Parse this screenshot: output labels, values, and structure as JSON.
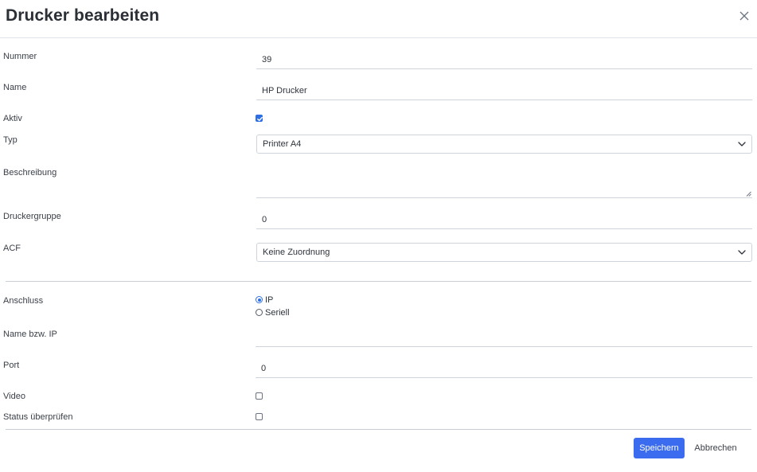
{
  "dialog": {
    "title": "Drucker bearbeiten",
    "close_icon": "close-icon"
  },
  "form": {
    "nummer": {
      "label": "Nummer",
      "value": "39"
    },
    "name": {
      "label": "Name",
      "value": "HP Drucker"
    },
    "aktiv": {
      "label": "Aktiv",
      "checked": true
    },
    "typ": {
      "label": "Typ",
      "selected": "Printer A4"
    },
    "beschreibung": {
      "label": "Beschreibung",
      "value": ""
    },
    "druckergruppe": {
      "label": "Druckergruppe",
      "value": "0"
    },
    "acf": {
      "label": "ACF",
      "selected": "Keine Zuordnung"
    },
    "anschluss": {
      "label": "Anschluss",
      "options": [
        {
          "label": "IP",
          "selected": true
        },
        {
          "label": "Seriell",
          "selected": false
        }
      ]
    },
    "name_ip": {
      "label": "Name bzw. IP",
      "value": ""
    },
    "port": {
      "label": "Port",
      "value": "0"
    },
    "video": {
      "label": "Video",
      "checked": false
    },
    "status": {
      "label": "Status überprüfen",
      "checked": false
    }
  },
  "footer": {
    "save_label": "Speichern",
    "cancel_label": "Abbrechen"
  },
  "colors": {
    "primary": "#3b6cf0",
    "checkbox_checked": "#2f6fe4"
  }
}
